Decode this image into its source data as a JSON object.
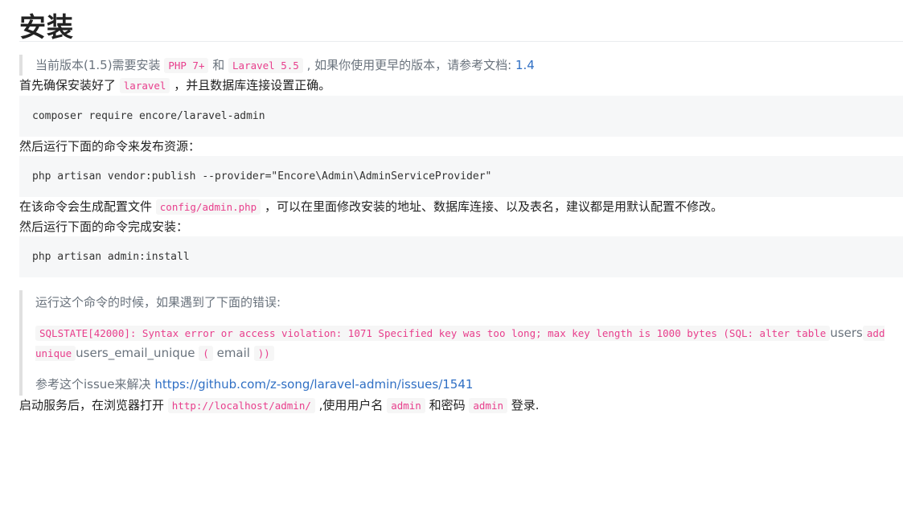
{
  "title": "安装",
  "note1": {
    "text_before": "当前版本(1.5)需要安装 ",
    "code_php": "PHP 7+",
    "text_and": " 和 ",
    "code_laravel": "Laravel 5.5",
    "text_after": " , 如果你使用更早的版本，请参考文档: ",
    "link": "1.4"
  },
  "para1": {
    "text_before": "首先确保安装好了 ",
    "code": "laravel",
    "text_after": " ，并且数据库连接设置正确。"
  },
  "code1": "composer require encore/laravel-admin",
  "para2": "然后运行下面的命令来发布资源：",
  "code2": "php artisan vendor:publish --provider=\"Encore\\Admin\\AdminServiceProvider\"",
  "para3": {
    "text_before": "在该命令会生成配置文件 ",
    "code": "config/admin.php",
    "text_after": " ，可以在里面修改安装的地址、数据库连接、以及表名，建议都是用默认配置不修改。"
  },
  "para4": "然后运行下面的命令完成安装：",
  "code3": "php artisan admin:install",
  "note2": {
    "line1": "运行这个命令的时候，如果遇到了下面的错误:",
    "err_code1": "SQLSTATE[42000]: Syntax error or access violation: 1071 Specified key was too long; max key length is 1000 bytes (SQL: alter table",
    "err_text1": "users",
    "err_code2": "add unique",
    "err_text2": "users_email_unique",
    "err_code3": "(",
    "err_text3": "email",
    "err_code4": "))",
    "line3_text": "参考这个issue来解决 ",
    "line3_link": "https://github.com/z-song/laravel-admin/issues/1541"
  },
  "para5": {
    "text1": "启动服务后，在浏览器打开 ",
    "code_url": "http://localhost/admin/",
    "text2": " ,使用用户名 ",
    "code_user": "admin",
    "text3": " 和密码 ",
    "code_pass": "admin",
    "text4": " 登录."
  }
}
